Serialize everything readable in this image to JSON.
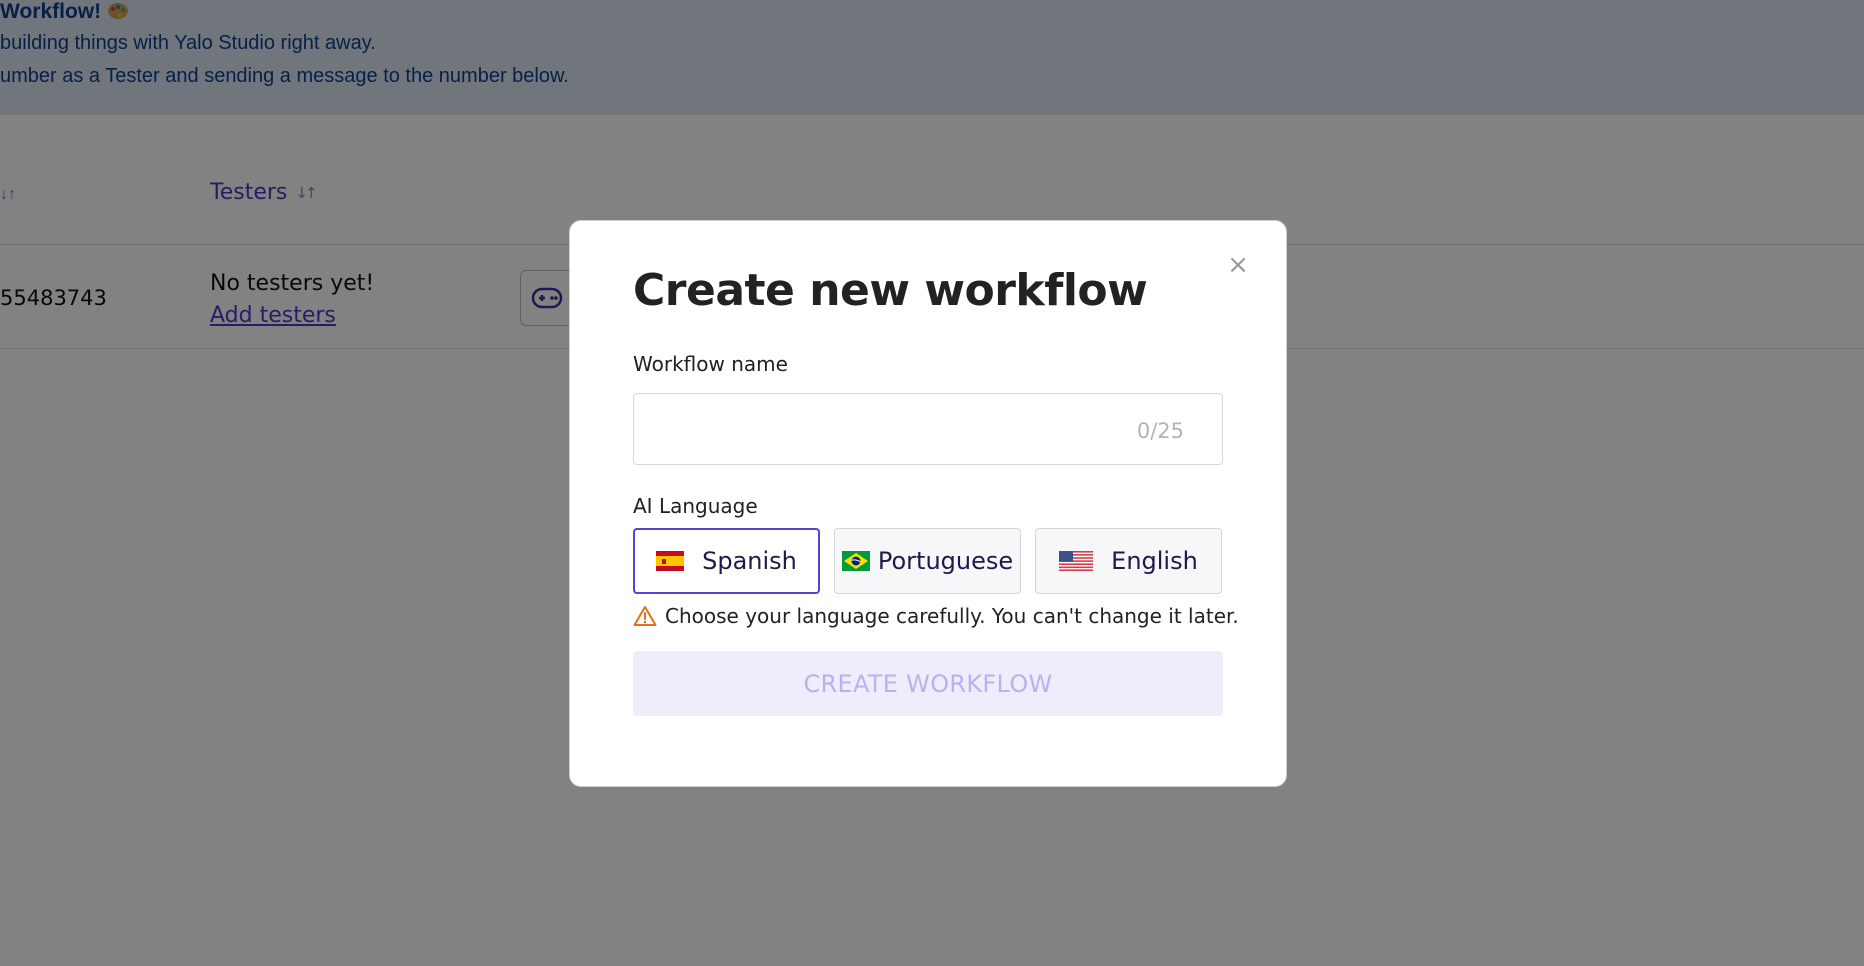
{
  "background": {
    "banner": {
      "title": "Workflow!",
      "line1": "building things with Yalo Studio right away.",
      "line2": "umber as a Tester and sending a message to the number below."
    },
    "table": {
      "testers_header": "Testers",
      "row_id": "55483743",
      "no_testers": "No testers yet!",
      "add_testers": "Add testers"
    }
  },
  "modal": {
    "title": "Create new workflow",
    "close_glyph": "×",
    "name_label": "Workflow name",
    "name_value": "",
    "name_placeholder": "",
    "char_count": "0/25",
    "language_label": "AI Language",
    "languages": [
      {
        "label": "Spanish",
        "flag": "spain-flag-icon",
        "selected": true
      },
      {
        "label": "Portuguese",
        "flag": "brazil-flag-icon",
        "selected": false
      },
      {
        "label": "English",
        "flag": "us-flag-icon",
        "selected": false
      }
    ],
    "warning": "Choose your language carefully. You can't change it later.",
    "create_button": "CREATE WORKFLOW"
  },
  "colors": {
    "accent": "#5345d6",
    "link": "#4b39c7",
    "warning": "#e0701b",
    "disabled_button_bg": "#eeedfb",
    "disabled_button_text": "#b8b2ee"
  }
}
